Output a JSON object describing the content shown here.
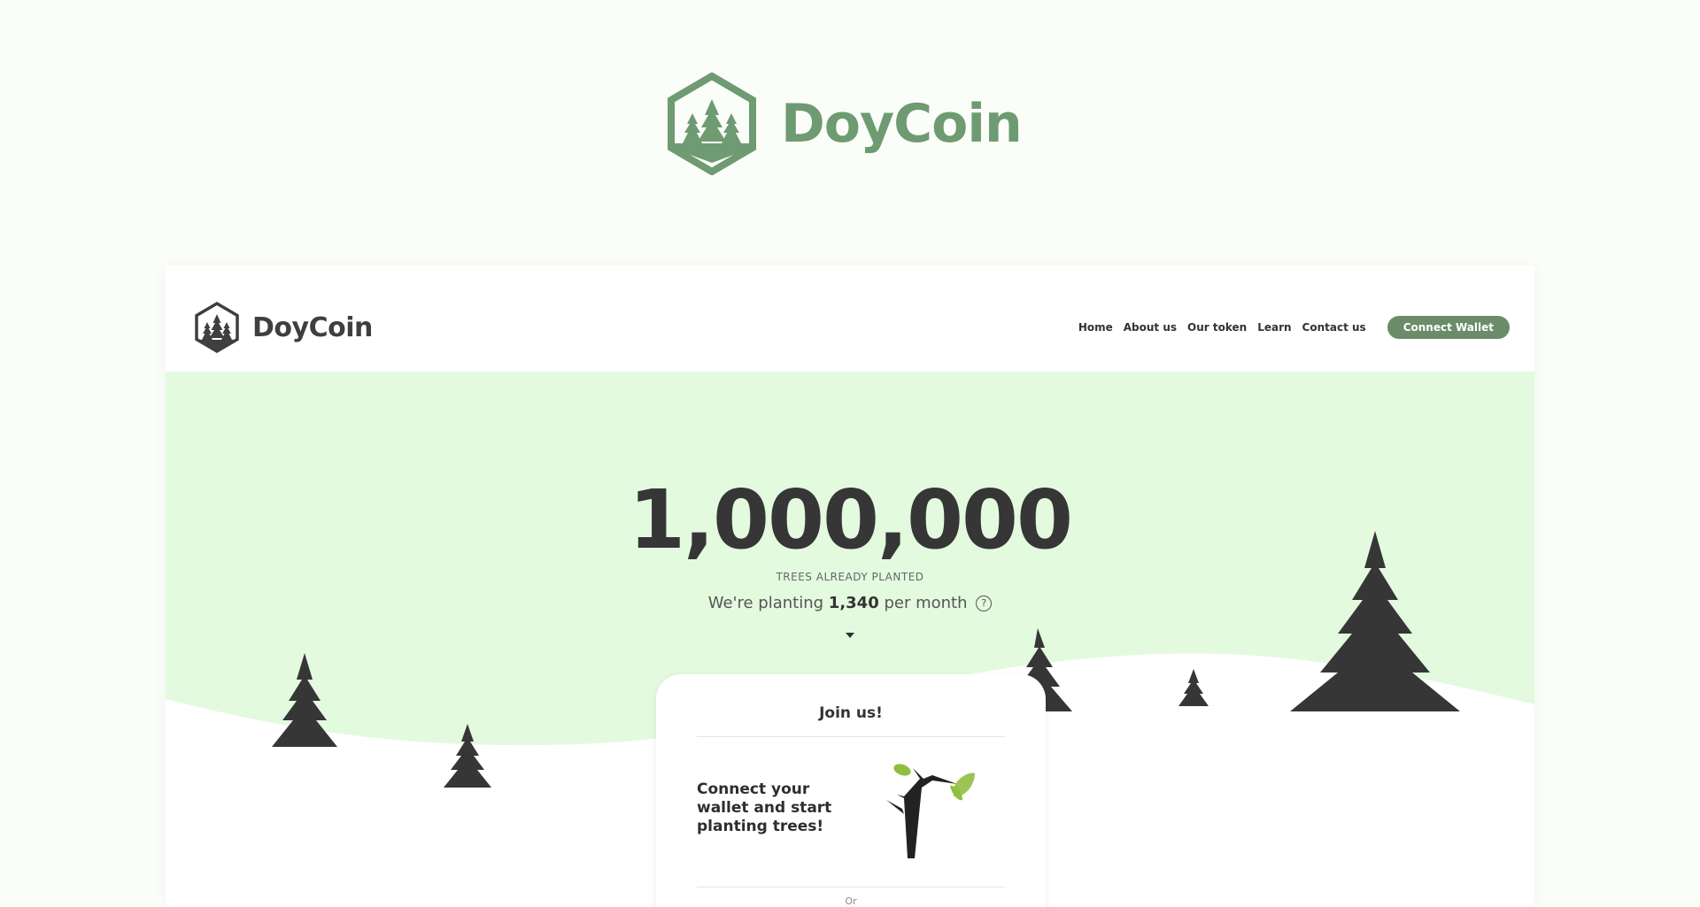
{
  "hero_logo": {
    "wordmark": "DoyCoin",
    "color": "#6e9b71"
  },
  "site": {
    "navbar": {
      "brand": "DoyCoin",
      "links": [
        "Home",
        "About us",
        "Our token",
        "Learn",
        "Contact us"
      ],
      "connect_label": "Connect Wallet",
      "accent": "#6a8c68"
    },
    "hero": {
      "count": "1,000,000",
      "count_label": "TREES ALREADY PLANTED",
      "rate_prefix": "We're planting",
      "rate_value": "1,340",
      "rate_suffix": "per month",
      "help_icon": "question-circle-icon",
      "background": "#e3fadf"
    },
    "join": {
      "title": "Join us!",
      "text": "Connect your wallet and start planting trees!",
      "or": "Or"
    }
  }
}
